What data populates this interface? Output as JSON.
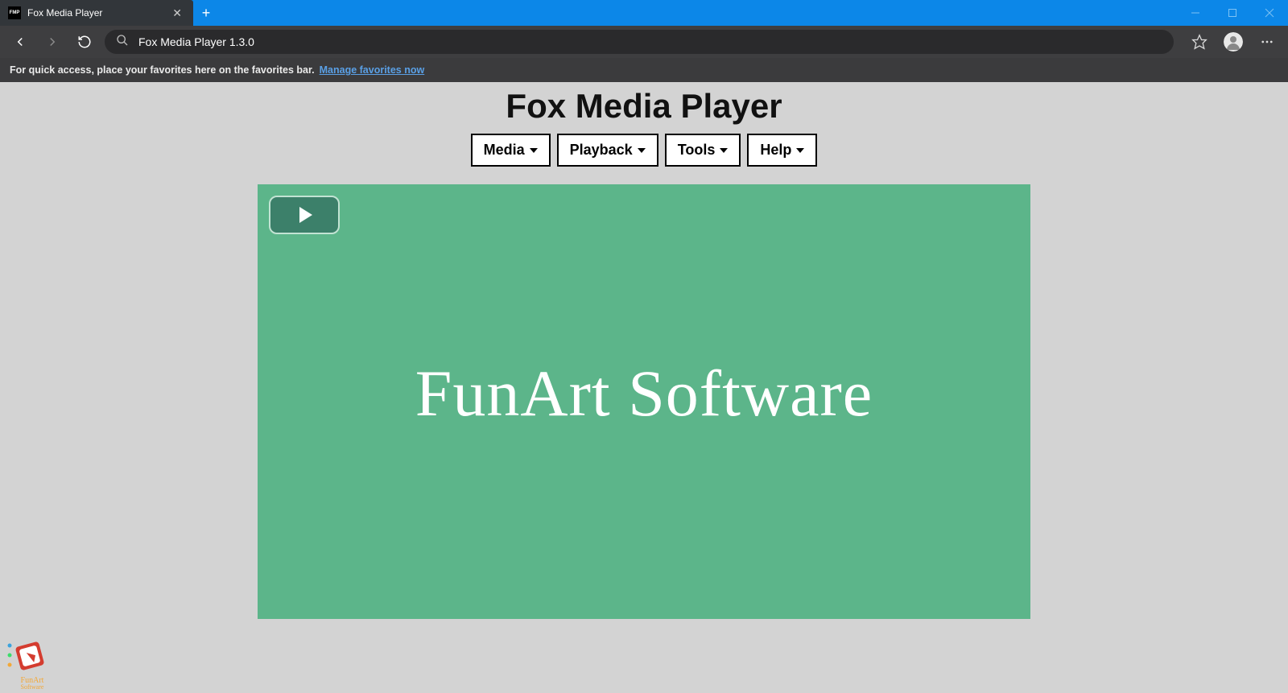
{
  "window": {
    "tab_title": "Fox Media Player",
    "favicon_text": "FMP"
  },
  "toolbar": {
    "url_text": "Fox Media Player 1.3.0"
  },
  "favbar": {
    "hint": "For quick access, place your favorites here on the favorites bar.",
    "link": "Manage favorites now"
  },
  "page": {
    "title": "Fox Media Player",
    "menus": {
      "media": "Media",
      "playback": "Playback",
      "tools": "Tools",
      "help": "Help"
    },
    "brand": "FunArt Software",
    "corner_brand": "FunArt Software"
  },
  "colors": {
    "titlebar": "#0c87e8",
    "chrome": "#3e3e40",
    "player_bg": "#5cb58a"
  }
}
